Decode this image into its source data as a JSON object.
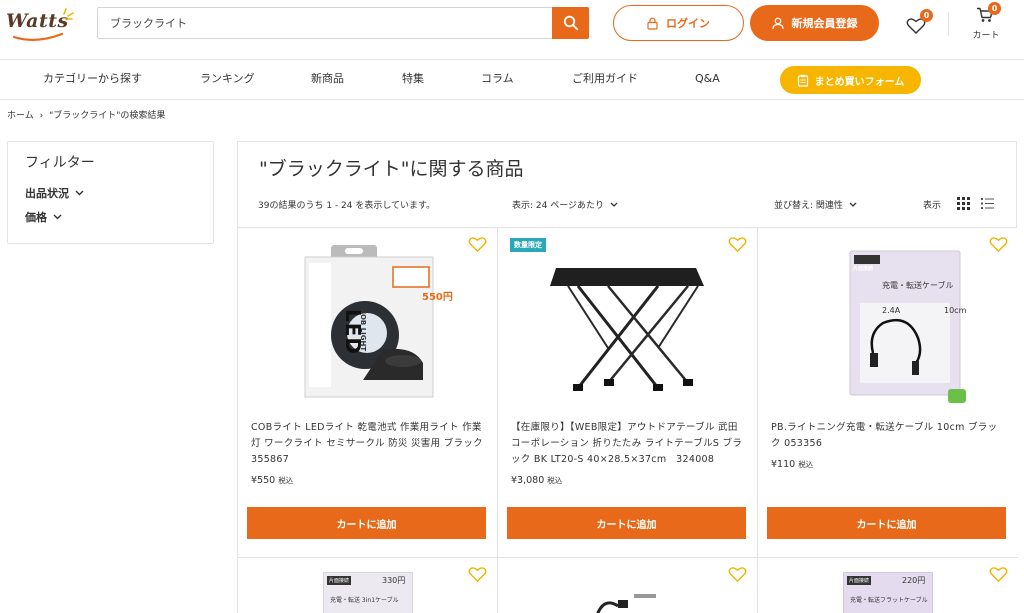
{
  "header": {
    "logo_text": "Watts",
    "search": {
      "value": "ブラックライト",
      "placeholder": ""
    },
    "login_label": "ログイン",
    "register_label": "新規会員登録",
    "wishlist_count": "0",
    "cart_count": "0",
    "cart_label": "カート",
    "accent_color": "#e8691a"
  },
  "nav": {
    "items": [
      "カテゴリーから探す",
      "ランキング",
      "新商品",
      "特集",
      "コラム",
      "ご利用ガイド",
      "Q&A"
    ],
    "bulk_button": "まとめ買いフォーム",
    "bulk_color": "#f7b500"
  },
  "breadcrumb": {
    "home": "ホーム",
    "separator": "›",
    "current": "\"ブラックライト\"の検索結果"
  },
  "filter": {
    "title": "フィルター",
    "options": [
      "出品状況",
      "価格"
    ]
  },
  "results": {
    "title": "\"ブラックライト\"に関する商品",
    "count_text": "39の結果のうち 1 - 24 を表示しています。",
    "per_page": "表示: 24 ページあたり",
    "sort": "並び替え: 関連性",
    "view_label": "表示"
  },
  "products": [
    {
      "tag": "",
      "name": "COBライト LEDライト 乾電池式 作業用ライト 作業灯 ワークライト セミサークル 防災 災害用 ブラック　355867",
      "price": "¥550",
      "tax": "税込",
      "button": "カートに追加",
      "box_text": "LED",
      "box_sub": "COB LIGHT",
      "box_price": "550円"
    },
    {
      "tag": "数量限定",
      "name": "【在庫限り】【WEB限定】アウトドアテーブル 武田コーポレーション 折りたたみ ライトテーブルS ブラック BK LT20-S 40×28.5×37cm　324008",
      "price": "¥3,080",
      "tax": "税込",
      "button": "カートに追加"
    },
    {
      "tag": "",
      "name": "PB.ライトニング充電・転送ケーブル 10cm ブラック 053356",
      "price": "¥110",
      "tax": "税込",
      "button": "カートに追加",
      "pack_label": "充電・転送ケーブル",
      "pack_spec_a": "2.4A",
      "pack_spec_b": "10cm",
      "pack_head": "片面接続"
    }
  ],
  "partial_products": [
    {
      "pack_price": "330円",
      "pack_head": "片面接続",
      "pack_label": "充電・転送 3in1ケーブル"
    },
    {
      "pack_head": ""
    },
    {
      "pack_price": "220円",
      "pack_head": "片面接続",
      "pack_label": "充電・転送フラットケーブル"
    }
  ]
}
